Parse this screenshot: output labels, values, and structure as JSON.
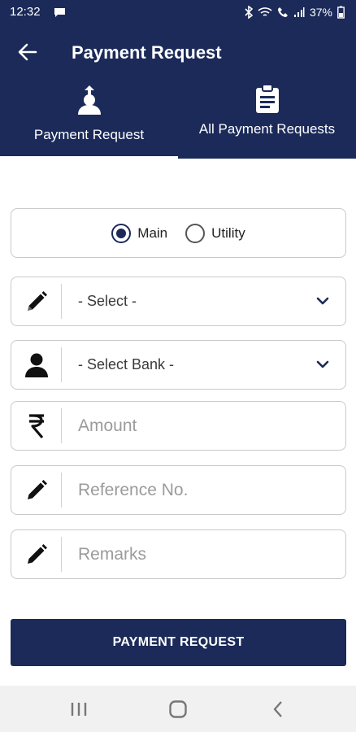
{
  "status_bar": {
    "time": "12:32",
    "battery": "37%"
  },
  "app_bar": {
    "title": "Payment Request"
  },
  "tabs": [
    {
      "label": "Payment Request",
      "icon": "user-upload-icon"
    },
    {
      "label": "All Payment Requests",
      "icon": "clipboard-icon"
    }
  ],
  "form": {
    "radio_options": [
      {
        "label": "Main",
        "selected": true
      },
      {
        "label": "Utility",
        "selected": false
      }
    ],
    "type_select": {
      "value": "- Select -"
    },
    "bank_select": {
      "value": "- Select Bank -"
    },
    "amount": {
      "placeholder": "Amount",
      "value": ""
    },
    "reference": {
      "placeholder": "Reference No.",
      "value": ""
    },
    "remarks": {
      "placeholder": "Remarks",
      "value": ""
    },
    "submit_label": "PAYMENT REQUEST"
  },
  "colors": {
    "primary": "#1b2a59",
    "border": "#c9c9c9",
    "nav_bg": "#f1f1f1"
  }
}
